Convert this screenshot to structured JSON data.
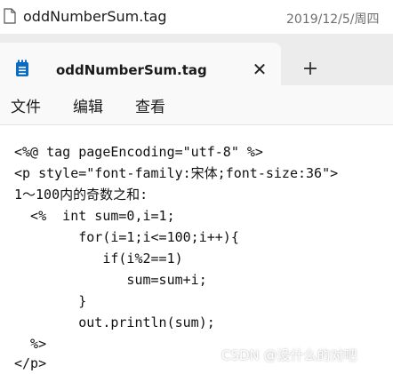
{
  "file": {
    "name": "oddNumberSum.tag",
    "date": "2019/12/5/周四"
  },
  "tab": {
    "label": "oddNumberSum.tag",
    "close_symbol": "✕",
    "new_tab_symbol": "+"
  },
  "menu": {
    "items": [
      "文件",
      "编辑",
      "查看"
    ]
  },
  "code": {
    "lines": [
      "<%@ tag pageEncoding=\"utf-8\" %>",
      "<p style=\"font-family:宋体;font-size:36\">",
      "1～100内的奇数之和:",
      "  <%  int sum=0,i=1;",
      "        for(i=1;i<=100;i++){",
      "           if(i%2==1)",
      "              sum=sum+i;",
      "        }",
      "        out.println(sum);",
      "  %>",
      "</p>"
    ]
  },
  "watermark": "CSDN @没什么的对吧",
  "colors": {
    "tabstrip_bg": "#ececec",
    "tab_bg": "#f9f9f9",
    "app_icon": "#0a6bc0"
  }
}
